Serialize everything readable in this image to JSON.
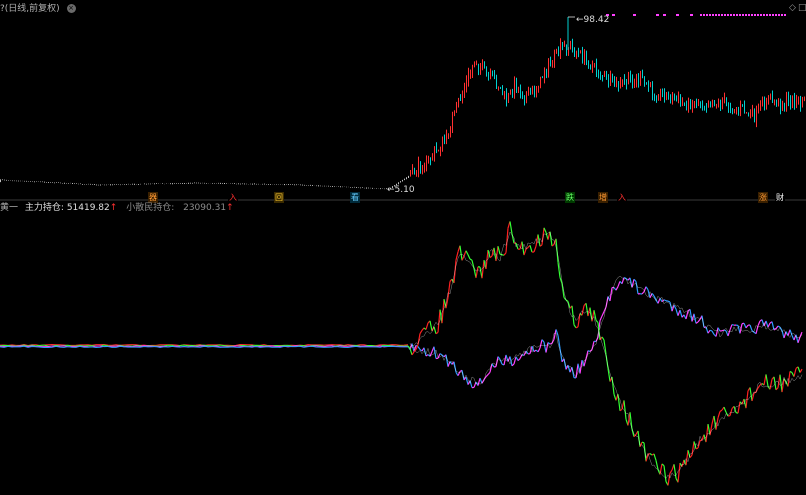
{
  "header": {
    "title": "?(日线,前复权)",
    "close_glyph": "×",
    "ctrl_diamond": "◇",
    "ctrl_square": "□"
  },
  "main_panel": {
    "high_label": "98.42",
    "low_label": "5.10",
    "high_arrow": "←",
    "low_arrow": "←",
    "marker_color": "#ff40ff",
    "up_color": "#ff3030",
    "down_color": "#00d0d0",
    "flat_color": "#c0c0c0"
  },
  "signals": [
    {
      "label": "器",
      "color": "#ff9933",
      "bg": "#3a2000"
    },
    {
      "label": "入",
      "color": "#ff3030",
      "bg": "#000000"
    },
    {
      "label": "回",
      "color": "#ffcc33",
      "bg": "#3a2a00"
    },
    {
      "label": "看",
      "color": "#66ccff",
      "bg": "#002a3a"
    },
    {
      "label": "跌",
      "color": "#66ff66",
      "bg": "#003a00"
    },
    {
      "label": "增",
      "color": "#ff9933",
      "bg": "#3a2000"
    },
    {
      "label": "入",
      "color": "#ff3030",
      "bg": "#000000"
    },
    {
      "label": "涨",
      "color": "#ff9933",
      "bg": "#3a2000"
    },
    {
      "label": "财",
      "color": "#ffffff",
      "bg": "#000000"
    }
  ],
  "sub_panel": {
    "name": "黄一",
    "main_label": "主力持仓:",
    "main_value": "51419.82",
    "retail_label": "小散民持仓:",
    "retail_value": "23090.31",
    "up_arrow": "↑",
    "main_up_color": "#ff2020",
    "main_down_color": "#33ff33",
    "retail_up_color": "#ff40ff",
    "retail_down_color": "#2e9bff",
    "baseline_colors": [
      "#ff3030",
      "#33ff33",
      "#ff40ff",
      "#2e9bff"
    ]
  },
  "chart_data": {
    "type": "candlestick",
    "high_value": 98.42,
    "low_value": 5.1,
    "indicators": [
      "主力持仓",
      "小散民持仓"
    ],
    "main_force_last": 51419.82,
    "retail_last": 23090.31
  }
}
